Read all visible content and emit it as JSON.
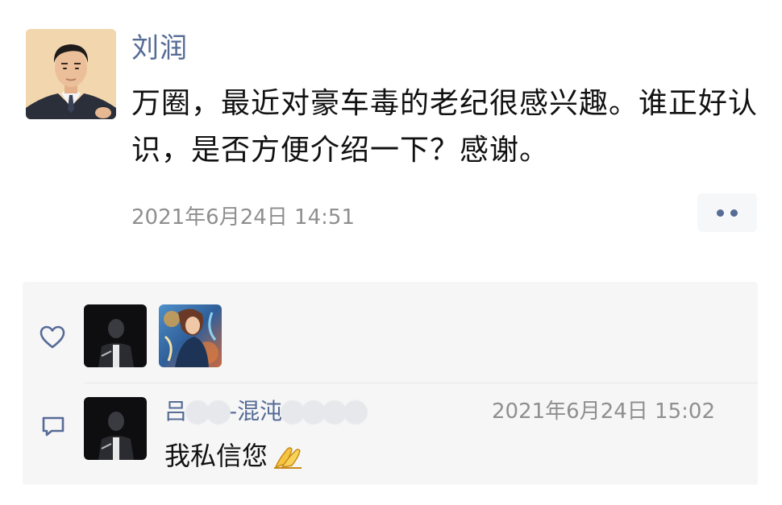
{
  "post": {
    "author": "刘润",
    "text": "万圈，最近对豪车毒的老纪很感兴趣。谁正好认识，是否方便介绍一下？感谢。",
    "time": "2021年6月24日 14:51"
  },
  "likes": {
    "icon": "heart-icon"
  },
  "comment": {
    "icon": "comment-icon",
    "author_part1": "吕",
    "author_part2": "-混沌",
    "time": "2021年6月24日 15:02",
    "text": "我私信您",
    "emoji": "pray-icon"
  },
  "colors": {
    "name_blue": "#566b95",
    "time_gray": "#8f8f8f",
    "panel_bg": "#f6f6f7"
  }
}
